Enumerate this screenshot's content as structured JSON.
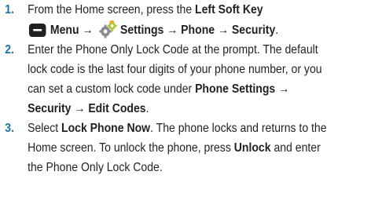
{
  "steps": [
    {
      "number": "1.",
      "line1_prefix": "From the Home screen, press the ",
      "line1_bold": "Left Soft Key",
      "line2_menu": "Menu →",
      "line2_path": "Settings → Phone → Security",
      "line2_end": "."
    },
    {
      "number": "2.",
      "text": "Enter the Phone Only Lock Code at the prompt. The default lock code is the last four digits of your phone number, or you can set a custom lock code under ",
      "bold": "Phone Settings → Security → Edit Codes",
      "end": "."
    },
    {
      "number": "3.",
      "t1": "Select ",
      "b1": "Lock Phone Now",
      "t2": ". The phone locks and returns to the Home screen. To unlock the phone, press ",
      "b2": "Unlock",
      "t3": " and enter the Phone Only Lock Code."
    }
  ],
  "icons": {
    "softkey": "left-softkey-icon",
    "settings": "settings-gears-icon"
  }
}
